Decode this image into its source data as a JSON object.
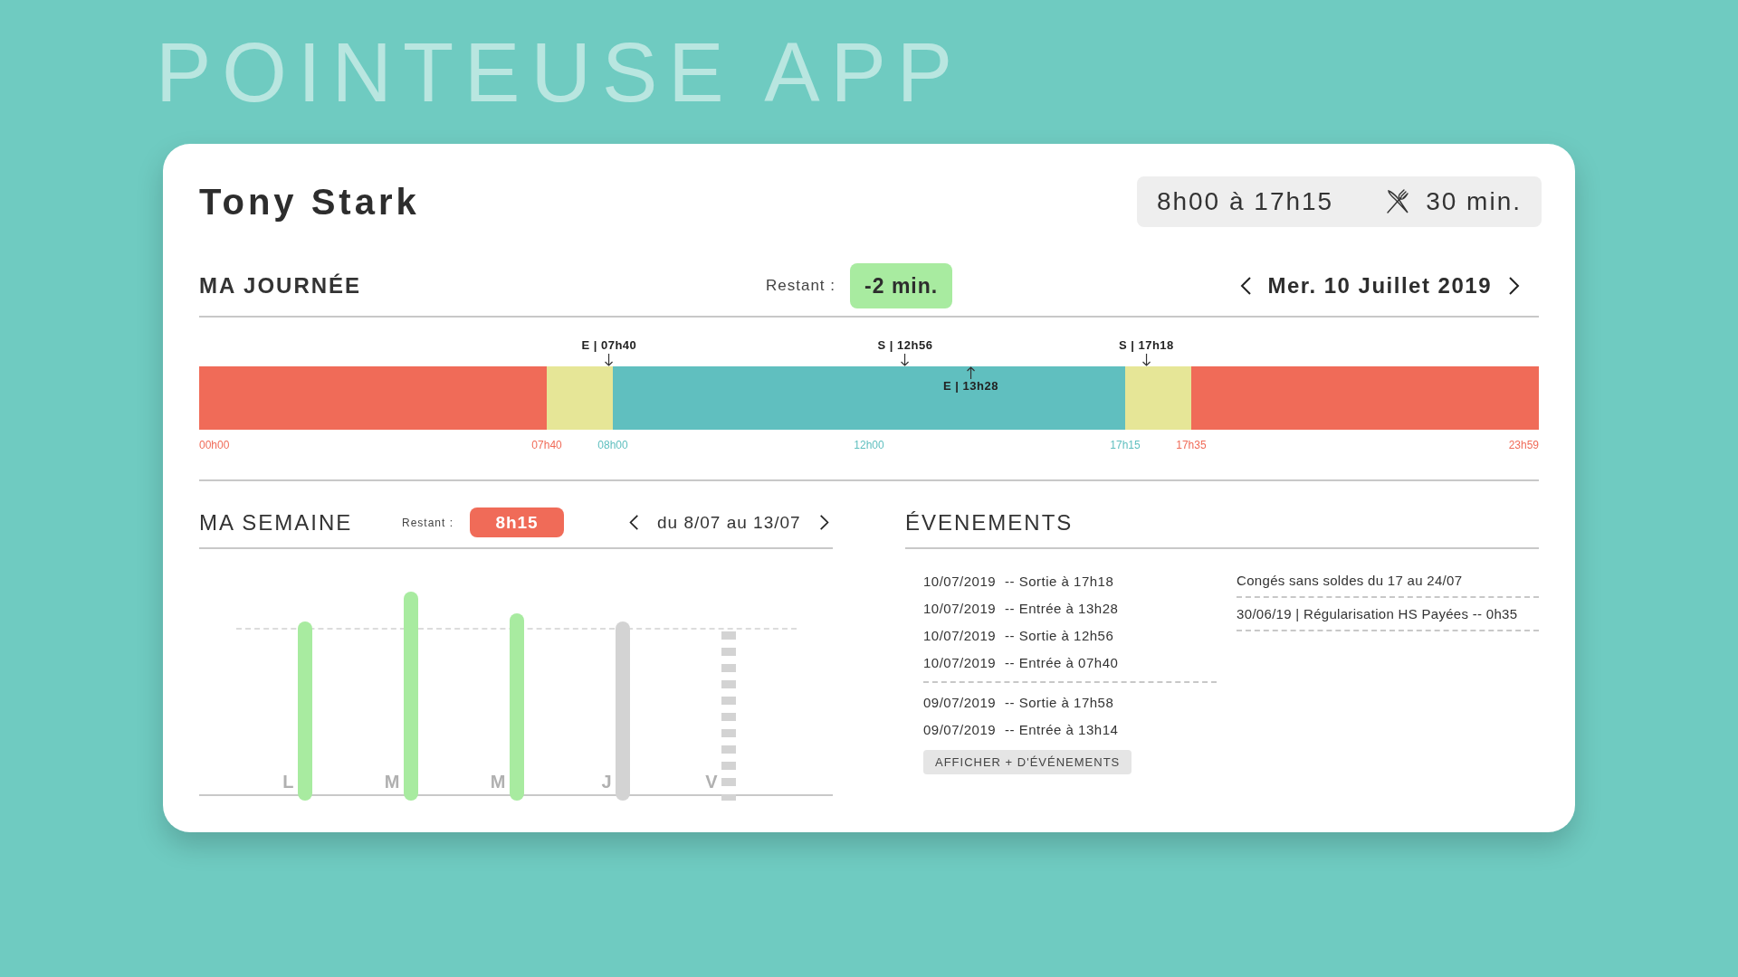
{
  "app_title": "POINTEUSE APP",
  "employee": {
    "name": "Tony Stark",
    "schedule": "8h00 à 17h15",
    "break": "30 min."
  },
  "day": {
    "title": "MA JOURNÉE",
    "remaining_label": "Restant :",
    "remaining": "-2 min.",
    "date": "Mer. 10 Juillet 2019",
    "segments": [
      {
        "kind": "off",
        "start_tick": {
          "label": "00h00",
          "color": "#f06b58"
        }
      },
      {
        "kind": "margin",
        "start_tick": {
          "label": "07h40",
          "color": "#f06b58"
        }
      },
      {
        "kind": "work",
        "start_tick": {
          "label": "08h00",
          "color": "#5fbfbf"
        },
        "mid_tick": {
          "label": "12h00",
          "color": "#5fbfbf"
        }
      },
      {
        "kind": "margin",
        "start_tick": {
          "label": "17h15",
          "color": "#5fbfbf"
        }
      },
      {
        "kind": "off",
        "start_tick": {
          "label": "17h35",
          "color": "#f06b58"
        },
        "end_tick": {
          "label": "23h59",
          "color": "#f06b58"
        }
      }
    ],
    "markers": [
      {
        "label": "E | 07h40",
        "kind": "above",
        "level": 0.306
      },
      {
        "label": "S | 12h56",
        "kind": "above",
        "level": 0.527
      },
      {
        "label": "E | 13h28",
        "kind": "below",
        "level": 0.576
      },
      {
        "label": "S | 17h18",
        "kind": "above",
        "level": 0.707
      }
    ]
  },
  "week": {
    "title": "MA SEMAINE",
    "remaining_label": "Restant :",
    "remaining": "8h15",
    "range": "du 8/07 au 13/07",
    "days": [
      {
        "letter": "L",
        "kind": "done"
      },
      {
        "letter": "M",
        "kind": "done"
      },
      {
        "letter": "M",
        "kind": "done"
      },
      {
        "letter": "J",
        "kind": "today"
      },
      {
        "letter": "V",
        "kind": "upcoming"
      }
    ]
  },
  "events": {
    "title": "ÉVENEMENTS",
    "punch_groups": [
      {
        "entries": [
          {
            "date": "10/07/2019",
            "text": "-- Sortie à 17h18"
          },
          {
            "date": "10/07/2019",
            "text": "-- Entrée à 13h28"
          },
          {
            "date": "10/07/2019",
            "text": "-- Sortie à 12h56"
          },
          {
            "date": "10/07/2019",
            "text": "-- Entrée à 07h40"
          }
        ]
      },
      {
        "entries": [
          {
            "date": "09/07/2019",
            "text": "-- Sortie à 17h58"
          },
          {
            "date": "09/07/2019",
            "text": "-- Entrée à 13h14"
          }
        ]
      }
    ],
    "more_button": "AFFICHER + D'ÉVÉNEMENTS",
    "notices": [
      "Congés sans soldes du 17 au 24/07",
      "30/06/19 | Régularisation HS Payées -- 0h35"
    ]
  }
}
